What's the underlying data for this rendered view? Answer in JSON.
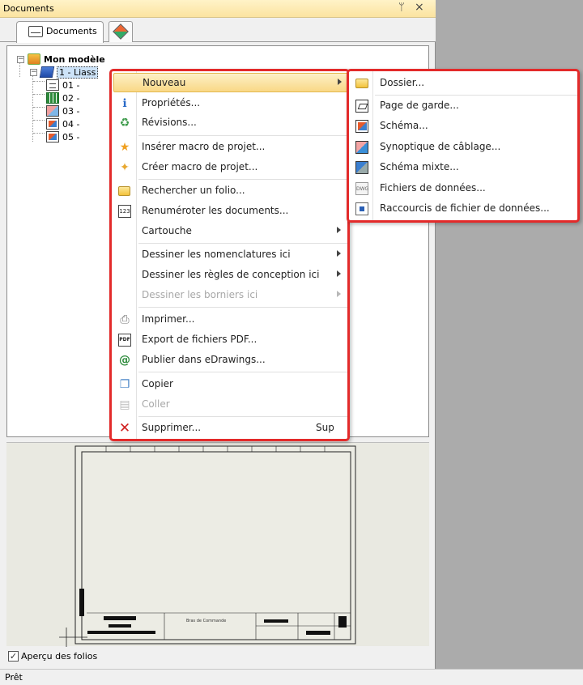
{
  "panel": {
    "title": "Documents",
    "pin_glyph": "ᛘ",
    "close_glyph": "×",
    "tab_documents": "Documents"
  },
  "tree": {
    "root": "Mon modèle",
    "book": "1 - Liass",
    "items": [
      "01 -",
      "02 -",
      "03 -",
      "04 -",
      "05 -"
    ]
  },
  "preview_option": {
    "label": "Aperçu des folios",
    "checked": true
  },
  "titleblock_text": "Bras de Commande",
  "status": "Prêt",
  "context_menu": {
    "items": [
      {
        "label": "Nouveau",
        "submenu": true,
        "highlighted": true
      },
      {
        "label": "Propriétés...",
        "icon": "info-icon"
      },
      {
        "label": "Révisions...",
        "icon": "revisions-icon"
      },
      {
        "label": "Insérer macro de projet...",
        "icon": "star-icon"
      },
      {
        "label": "Créer macro de projet...",
        "icon": "create-macro-icon"
      },
      {
        "label": "Rechercher un folio...",
        "icon": "search-folder-icon"
      },
      {
        "label": "Renuméroter les documents...",
        "icon": "renumber-icon"
      },
      {
        "label": "Cartouche",
        "submenu": true
      },
      {
        "label": "Dessiner les nomenclatures ici",
        "submenu": true
      },
      {
        "label": "Dessiner les règles de conception ici",
        "submenu": true
      },
      {
        "label": "Dessiner les borniers ici",
        "submenu": true,
        "disabled": true
      },
      {
        "label": "Imprimer...",
        "icon": "print-icon"
      },
      {
        "label": "Export de fichiers PDF...",
        "icon": "pdf-icon"
      },
      {
        "label": "Publier dans eDrawings...",
        "icon": "edrawings-icon"
      },
      {
        "label": "Copier",
        "icon": "copy-icon"
      },
      {
        "label": "Coller",
        "icon": "paste-icon",
        "disabled": true
      },
      {
        "label": "Supprimer...",
        "icon": "delete-icon",
        "shortcut": "Sup"
      }
    ],
    "renumber_glyph": "123",
    "pdf_glyph": "PDF"
  },
  "submenu": {
    "items": [
      {
        "label": "Dossier...",
        "icon": "folder-icon"
      },
      {
        "label": "Page de garde...",
        "icon": "cover-page-icon"
      },
      {
        "label": "Schéma...",
        "icon": "schematic-icon"
      },
      {
        "label": "Synoptique de câblage...",
        "icon": "wiring-synoptic-icon"
      },
      {
        "label": "Schéma mixte...",
        "icon": "mixed-schematic-icon"
      },
      {
        "label": "Fichiers de données...",
        "icon": "data-file-icon"
      },
      {
        "label": "Raccourcis de fichier de données...",
        "icon": "data-shortcut-icon"
      }
    ],
    "dwg_glyph": "DWG"
  },
  "colors": {
    "highlight_border": "#e32a2a",
    "menu_hover": "#f9d886"
  }
}
